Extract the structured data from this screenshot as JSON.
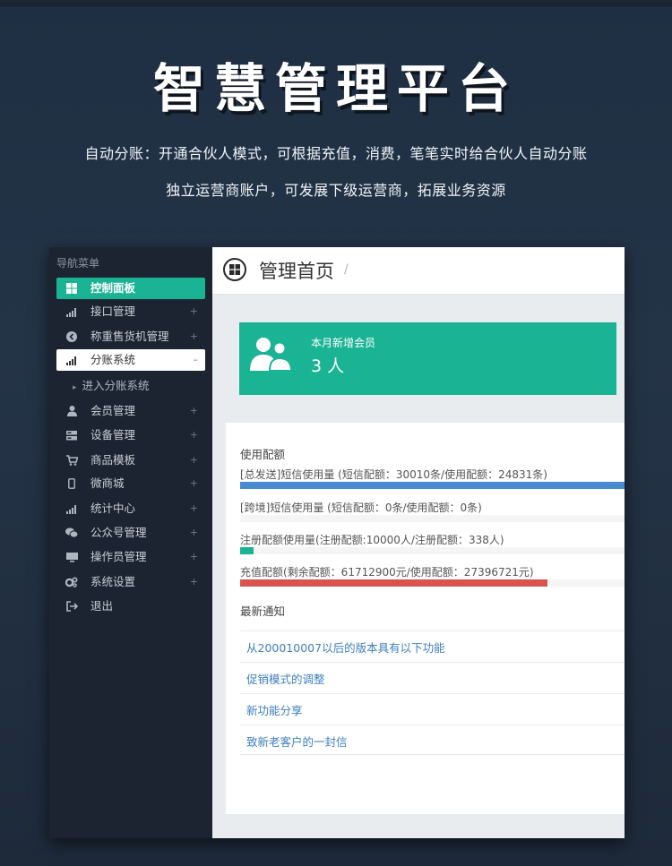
{
  "hero": {
    "title": "智慧管理平台",
    "line1": "自动分账：开通合伙人模式，可根据充值，消费，笔笔实时给合伙人自动分账",
    "line2": "独立运营商账户，可发展下级运营商，拓展业务资源"
  },
  "sidebar": {
    "heading": "导航菜单",
    "items": [
      {
        "label": "控制面板",
        "icon": "windows-icon",
        "plus": ""
      },
      {
        "label": "接口管理",
        "icon": "signal-icon",
        "plus": "+"
      },
      {
        "label": "称重售货机管理",
        "icon": "chevron-circle-icon",
        "plus": "+"
      },
      {
        "label": "分账系统",
        "icon": "signal-icon",
        "plus": "–"
      },
      {
        "label": "会员管理",
        "icon": "user-icon",
        "plus": "+"
      },
      {
        "label": "设备管理",
        "icon": "server-icon",
        "plus": "+"
      },
      {
        "label": "商品模板",
        "icon": "cart-icon",
        "plus": "+"
      },
      {
        "label": "微商城",
        "icon": "mobile-icon",
        "plus": "+"
      },
      {
        "label": "统计中心",
        "icon": "signal-icon",
        "plus": "+"
      },
      {
        "label": "公众号管理",
        "icon": "wechat-icon",
        "plus": "+"
      },
      {
        "label": "操作员管理",
        "icon": "monitor-icon",
        "plus": "+"
      },
      {
        "label": "系统设置",
        "icon": "gears-icon",
        "plus": "+"
      },
      {
        "label": "退出",
        "icon": "sign-out-icon",
        "plus": ""
      }
    ],
    "sub_item": "进入分账系统"
  },
  "main": {
    "title": "管理首页",
    "crumb_sep": "/",
    "stat": {
      "label": "本月新增会员",
      "value": "3 人"
    },
    "usage": {
      "title": "使用配额",
      "bars": [
        {
          "label": "[总发送]短信使用量 (短信配额：30010条/使用配额：24831条)",
          "fraction": 1.0,
          "color": "#4a8ad0"
        },
        {
          "label": "[跨境]短信使用量 (短信配额：0条/使用配额：0条)",
          "fraction": 0.0,
          "color": "#4a8ad0"
        },
        {
          "label": "注册配额使用量(注册配额:10000人/注册配额：338人)",
          "fraction": 0.0338,
          "color": "#1ab394"
        },
        {
          "label": "充值配额(剩余配额：61712900元/使用配额：27396721元)",
          "fraction": 0.8,
          "color": "#d9534f"
        }
      ]
    },
    "notices": {
      "title": "最新通知",
      "items": [
        "从200010007以后的版本具有以下功能",
        "促销模式的调整",
        "新功能分享",
        "致新老客户的一封信"
      ]
    }
  }
}
